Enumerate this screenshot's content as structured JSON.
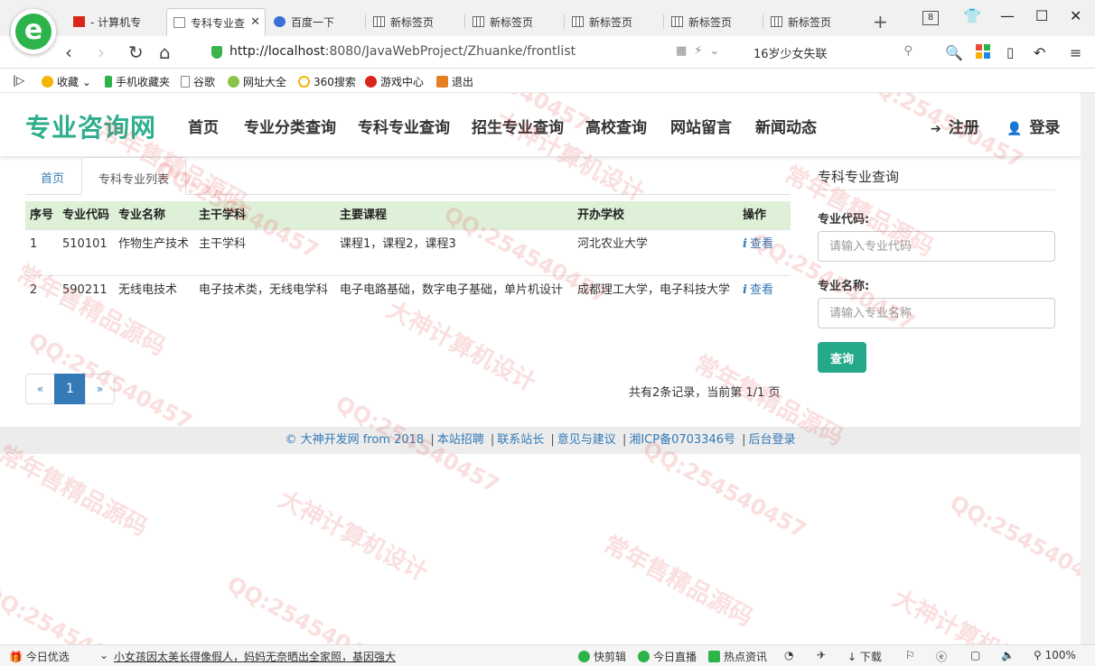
{
  "browser": {
    "tabs": [
      {
        "label": "- 计算机专",
        "icon": "flag-icon",
        "active": false
      },
      {
        "label": "专科专业查",
        "icon": "page-icon",
        "active": true
      },
      {
        "label": "百度一下",
        "icon": "baidu-paw-icon",
        "active": false
      },
      {
        "label": "新标签页",
        "icon": "grid-icon",
        "active": false
      },
      {
        "label": "新标签页",
        "icon": "grid-icon",
        "active": false
      },
      {
        "label": "新标签页",
        "icon": "grid-icon",
        "active": false
      },
      {
        "label": "新标签页",
        "icon": "grid-icon",
        "active": false
      },
      {
        "label": "新标签页",
        "icon": "grid-icon",
        "active": false
      }
    ],
    "tab_count": "8",
    "url_host": "http://localhost",
    "url_rest": ":8080/JavaWebProject/Zhuanke/frontlist",
    "search_text": "16岁少女失联",
    "favorites": [
      "收藏",
      "手机收藏夹",
      "谷歌",
      "网址大全",
      "360搜索",
      "游戏中心",
      "退出"
    ]
  },
  "site": {
    "logo": "专业咨询网",
    "nav": [
      "首页",
      "专业分类查询",
      "专科专业查询",
      "招生专业查询",
      "高校查询",
      "网站留言",
      "新闻动态"
    ],
    "register": "注册",
    "login": "登录",
    "accent": "#2fae8d"
  },
  "breadcrumb": {
    "home": "首页",
    "current": "专科专业列表"
  },
  "table": {
    "headers": [
      "序号",
      "专业代码",
      "专业名称",
      "主干学科",
      "主要课程",
      "开办学校",
      "操作"
    ],
    "rows": [
      [
        "1",
        "510101",
        "作物生产技术",
        "主干学科",
        "课程1，课程2，课程3",
        "河北农业大学",
        "查看"
      ],
      [
        "2",
        "590211",
        "无线电技术",
        "电子技术类，无线电学科",
        "电子电路基础，数字电子基础，单片机设计",
        "成都理工大学，电子科技大学",
        "查看"
      ]
    ]
  },
  "pagination": {
    "prev": "«",
    "current": "1",
    "next": "»",
    "info": "共有2条记录，当前第 1/1 页"
  },
  "sidebar": {
    "title": "专科专业查询",
    "code_label": "专业代码:",
    "code_placeholder": "请输入专业代码",
    "name_label": "专业名称:",
    "name_placeholder": "请输入专业名称",
    "query_button": "查询"
  },
  "footer": {
    "copyright": "© 大神开发网 from 2018",
    "links": [
      "本站招聘",
      "联系站长",
      "意见与建议",
      "湘ICP备0703346号",
      "后台登录"
    ]
  },
  "watermarks": [
    "QQ:254540457",
    "大神计算机设计",
    "常年售精品源码"
  ],
  "statusbar": {
    "today": "今日优选",
    "news": "小女孩因太美长得像假人，妈妈无奈晒出全家照，基因强大",
    "items": [
      "快剪辑",
      "今日直播",
      "热点资讯",
      "下载"
    ],
    "zoom": "100%"
  }
}
